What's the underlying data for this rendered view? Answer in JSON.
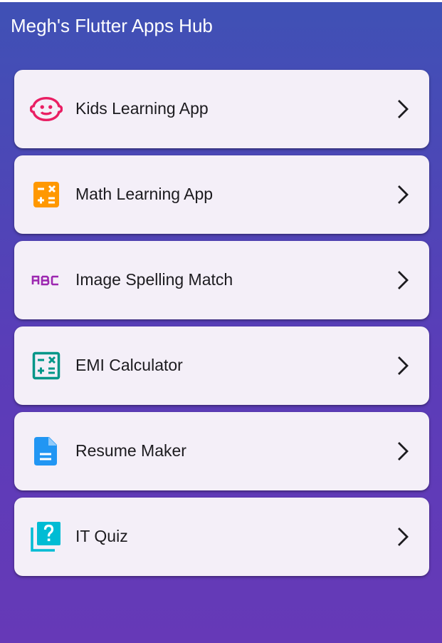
{
  "app_bar": {
    "title": "Megh's Flutter Apps Hub"
  },
  "apps": [
    {
      "label": "Kids Learning App",
      "icon": "child-face-icon",
      "icon_color": "#E91E63"
    },
    {
      "label": "Math Learning App",
      "icon": "calculate-icon",
      "icon_color": "#FF9800"
    },
    {
      "label": "Image Spelling Match",
      "icon": "abc-icon",
      "icon_color": "#9C27B0"
    },
    {
      "label": "EMI Calculator",
      "icon": "calculate-outline-icon",
      "icon_color": "#009688"
    },
    {
      "label": "Resume Maker",
      "icon": "document-icon",
      "icon_color": "#2196F3"
    },
    {
      "label": "IT Quiz",
      "icon": "quiz-icon",
      "icon_color": "#00BCD4"
    }
  ],
  "colors": {
    "background_top": "#3F51B5",
    "background_bottom": "#6639B7",
    "card": "#F4EFF8",
    "text": "#1C1B1F"
  }
}
